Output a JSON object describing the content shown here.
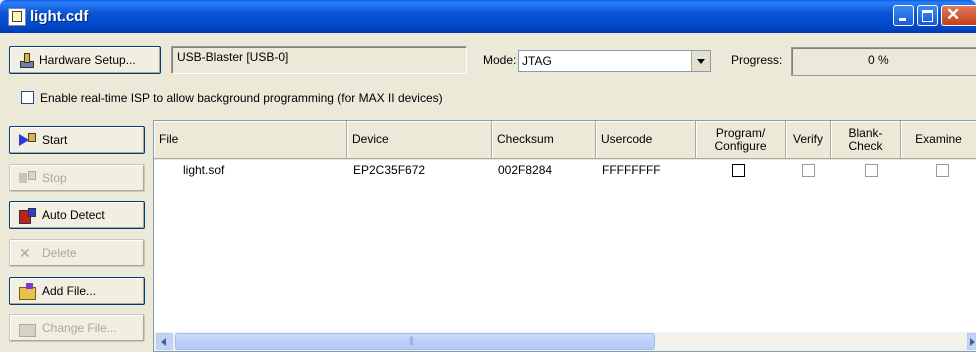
{
  "window": {
    "title": "light.cdf"
  },
  "toolbar": {
    "hardware_setup_label": "Hardware Setup...",
    "hardware_value": "USB-Blaster [USB-0]",
    "mode_label": "Mode:",
    "mode_value": "JTAG",
    "progress_label": "Progress:",
    "progress_value": "0 %"
  },
  "isp": {
    "label": "Enable real-time ISP to allow background programming (for MAX II devices)",
    "checked": false
  },
  "side_buttons": {
    "start": "Start",
    "stop": "Stop",
    "auto_detect": "Auto Detect",
    "delete": "Delete",
    "add_file": "Add File...",
    "change_file": "Change File..."
  },
  "table": {
    "columns": [
      "File",
      "Device",
      "Checksum",
      "Usercode",
      "Program/ Configure",
      "Verify",
      "Blank- Check",
      "Examine"
    ],
    "rows": [
      {
        "file": "light.sof",
        "device": "EP2C35F672",
        "checksum": "002F8284",
        "usercode": "FFFFFFFF",
        "program": false,
        "verify": false,
        "blank_check": false,
        "examine": false
      }
    ]
  },
  "colors": {
    "title_bar": "#0054E3",
    "close_button": "#C33F18",
    "face": "#ECE9D8"
  },
  "icons": [
    "hardware-icon",
    "start-icon",
    "stop-icon",
    "auto-detect-icon",
    "delete-icon",
    "add-file-icon",
    "change-file-icon"
  ]
}
